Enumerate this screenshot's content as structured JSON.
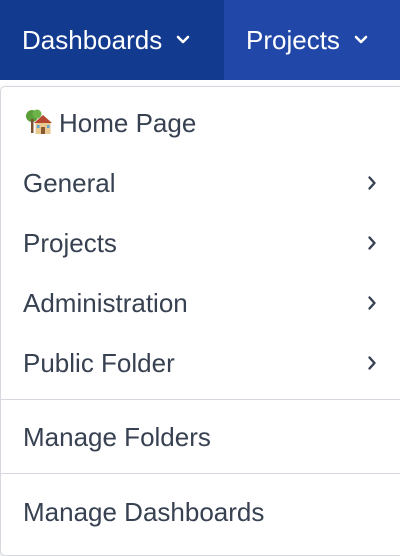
{
  "topnav": {
    "dashboards_label": "Dashboards",
    "projects_label": "Projects"
  },
  "menu": {
    "home_label": "Home Page",
    "items": [
      {
        "label": "General"
      },
      {
        "label": "Projects"
      },
      {
        "label": "Administration"
      },
      {
        "label": "Public Folder"
      }
    ],
    "manage_folders_label": "Manage Folders",
    "manage_dashboards_label": "Manage Dashboards"
  },
  "colors": {
    "nav_bg": "#2147a8",
    "nav_active_bg": "#123a8e",
    "menu_text": "#374151",
    "divider": "#d5d8de"
  },
  "icons": {
    "home": "home-icon",
    "submenu": "chevron-right-icon",
    "dropdown": "chevron-down-icon"
  }
}
